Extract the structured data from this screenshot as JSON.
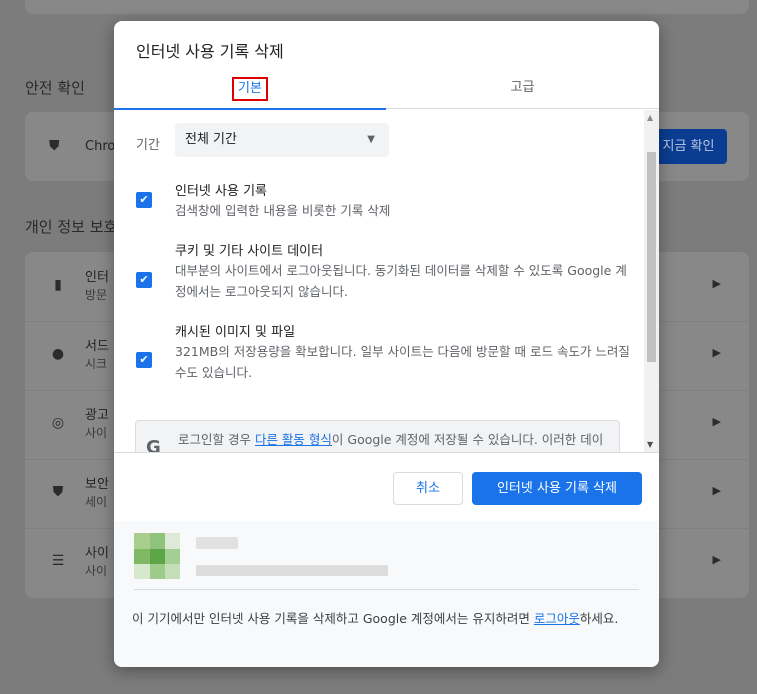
{
  "background": {
    "safety_check_heading": "안전 확인",
    "safety_check_text": "Chro",
    "safety_check_button": "지금 확인",
    "privacy_heading": "개인 정보 보호",
    "rows": [
      {
        "icon": "trash-icon",
        "title": "인터",
        "subtitle": "방문"
      },
      {
        "icon": "cookie-icon",
        "title": "서드",
        "subtitle": "시크"
      },
      {
        "icon": "ads-icon",
        "title": "광고",
        "subtitle": "사이"
      },
      {
        "icon": "shield-icon",
        "title": "보안",
        "subtitle": "세이"
      },
      {
        "icon": "sliders-icon",
        "title": "사이",
        "subtitle": "사이"
      }
    ]
  },
  "dialog": {
    "title": "인터넷 사용 기록 삭제",
    "tabs": {
      "basic": "기본",
      "advanced": "고급"
    },
    "time_range": {
      "label": "기간",
      "value": "전체 기간"
    },
    "options": [
      {
        "title": "인터넷 사용 기록",
        "description": "검색창에 입력한 내용을 비롯한 기록 삭제",
        "checked": true
      },
      {
        "title": "쿠키 및 기타 사이트 데이터",
        "description": "대부분의 사이트에서 로그아웃됩니다. 동기화된 데이터를 삭제할 수 있도록 Google 계정에서는 로그아웃되지 않습니다.",
        "checked": true
      },
      {
        "title": "캐시된 이미지 및 파일",
        "description": "321MB의 저장용량을 확보합니다. 일부 사이트는 다음에 방문할 때 로드 속도가 느려질 수도 있습니다.",
        "checked": true
      }
    ],
    "info": {
      "icon": "google-g-icon",
      "before": "로그인할 경우 ",
      "link": "다른 활동 형식",
      "after": "이 Google 계정에 저장될 수 있습니다. 이러한 데이터는 언제든지 삭제할 수 있습니다."
    },
    "buttons": {
      "cancel": "취소",
      "delete": "인터넷 사용 기록 삭제"
    },
    "footer": {
      "before": "이 기기에서만 인터넷 사용 기록을 삭제하고 Google 계정에서는 유지하려면 ",
      "link": "로그아웃",
      "after": "하세요."
    }
  },
  "colors": {
    "accent": "#1a73e8",
    "highlight_box": "#e00000"
  }
}
